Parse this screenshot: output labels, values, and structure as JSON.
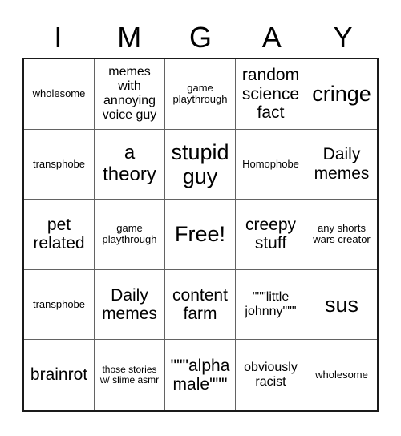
{
  "card": {
    "header_letters": [
      "I",
      "M",
      "G",
      "A",
      "Y"
    ],
    "rows": [
      [
        {
          "text": "wholesome",
          "size": "xs"
        },
        {
          "text": "memes with annoying voice guy",
          "size": "sm"
        },
        {
          "text": "game playthrough",
          "size": "xs"
        },
        {
          "text": "random science fact",
          "size": "md"
        },
        {
          "text": "cringe",
          "size": "xl"
        }
      ],
      [
        {
          "text": "transphobe",
          "size": "xs"
        },
        {
          "text": "a theory",
          "size": "lg"
        },
        {
          "text": "stupid guy",
          "size": "xl"
        },
        {
          "text": "Homophobe",
          "size": "xs"
        },
        {
          "text": "Daily memes",
          "size": "md"
        }
      ],
      [
        {
          "text": "pet related",
          "size": "md"
        },
        {
          "text": "game playthrough",
          "size": "xs"
        },
        {
          "text": "Free!",
          "size": "xl"
        },
        {
          "text": "creepy stuff",
          "size": "md"
        },
        {
          "text": "any shorts wars creator",
          "size": "xs"
        }
      ],
      [
        {
          "text": "transphobe",
          "size": "xs"
        },
        {
          "text": "Daily memes",
          "size": "md"
        },
        {
          "text": "content farm",
          "size": "md"
        },
        {
          "text": "\"\"\"little johnny\"\"\"",
          "size": "sm"
        },
        {
          "text": "sus",
          "size": "xl"
        }
      ],
      [
        {
          "text": "brainrot",
          "size": "md"
        },
        {
          "text": "those stories w/ slime asmr",
          "size": "xxs"
        },
        {
          "text": "\"\"\"alpha male\"\"\"",
          "size": "md"
        },
        {
          "text": "obviously racist",
          "size": "sm"
        },
        {
          "text": "wholesome",
          "size": "xs"
        }
      ]
    ]
  }
}
